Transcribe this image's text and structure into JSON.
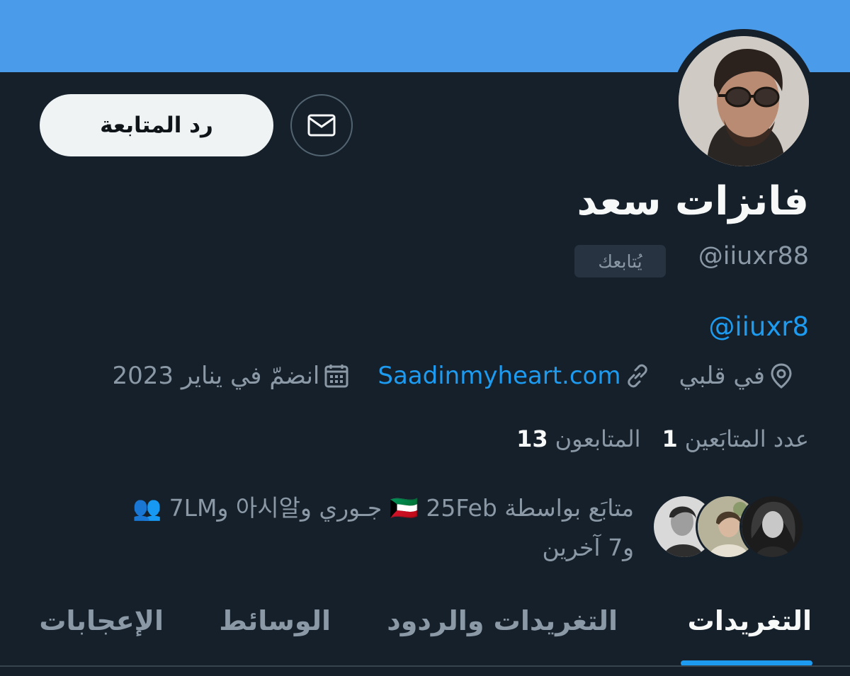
{
  "profile": {
    "display_name": "فانزات سعد",
    "handle": "@iiuxr88",
    "follows_you_badge": "يُتابعك",
    "bio_link": "@iiuxr8",
    "location": "في قلبي",
    "website": "Saadinmyheart.com",
    "joined": "انضمّ في يناير 2023",
    "avatar_icon": "profile-photo-man-sunglasses"
  },
  "actions": {
    "follow_back_label": "رد المتابعة",
    "message_icon": "envelope-icon"
  },
  "stats": {
    "following_count": "1",
    "following_label": "عدد المتابَعين",
    "followers_count": "13",
    "followers_label": "المتابعون"
  },
  "followed_by": {
    "line1": "متابَع بواسطة 🇰🇼 25Feb جـوري و아시알 و7LM 👥",
    "line2": "و7 آخرين"
  },
  "tabs": [
    {
      "label": "التغريدات",
      "active": true
    },
    {
      "label": "التغريدات والردود",
      "active": false
    },
    {
      "label": "الوسائط",
      "active": false
    },
    {
      "label": "الإعجابات",
      "active": false
    }
  ],
  "colors": {
    "background": "#15202b",
    "banner": "#4a9be9",
    "accent": "#1d9bf0",
    "muted_text": "#8b98a5"
  }
}
